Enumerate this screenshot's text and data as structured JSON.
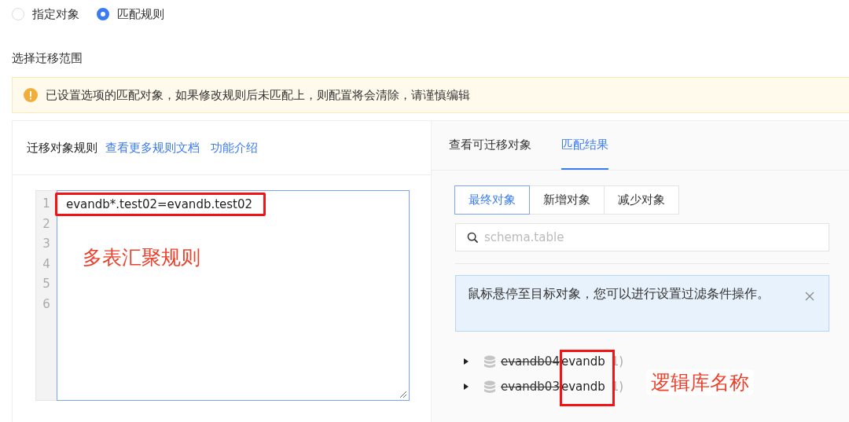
{
  "mode_radios": [
    {
      "label": "指定对象",
      "selected": false
    },
    {
      "label": "匹配规则",
      "selected": true
    }
  ],
  "section_title": "选择迁移范围",
  "warning": {
    "text": "已设置选项的匹配对象，如果修改规则后未匹配上，则配置将会清除，请谨慎编辑"
  },
  "rules_panel": {
    "title": "迁移对象规则",
    "links": [
      "查看更多规则文档",
      "功能介绍"
    ],
    "editor": {
      "lines": [
        {
          "number": "1",
          "text": "evandb*.test02=evandb.test02",
          "highlighted": true
        },
        {
          "number": "2",
          "highlighted": false
        },
        {
          "number": "3",
          "highlighted": false
        },
        {
          "number": "4",
          "highlighted": false
        },
        {
          "number": "5",
          "highlighted": false
        },
        {
          "number": "6",
          "highlighted": false
        }
      ],
      "annotation": "多表汇聚规则"
    }
  },
  "result_panel": {
    "tabs": [
      {
        "label": "查看可迁移对象",
        "selected": false
      },
      {
        "label": "匹配结果",
        "selected": true
      }
    ],
    "segments": [
      {
        "label": "最终对象",
        "selected": true
      },
      {
        "label": "新增对象",
        "selected": false
      },
      {
        "label": "减少对象",
        "selected": false
      }
    ],
    "search": {
      "placeholder": "schema.table"
    },
    "info": {
      "text": "鼠标悬停至目标对象，您可以进行设置过滤条件操作。"
    },
    "tree": [
      {
        "source": "evandb04",
        "target": "evandb",
        "count": "1)",
        "expanded": false
      },
      {
        "source": "evandb03",
        "target": "evandb",
        "count": "1)",
        "expanded": false
      }
    ],
    "tree_highlight": true,
    "annotation": "逻辑库名称"
  }
}
